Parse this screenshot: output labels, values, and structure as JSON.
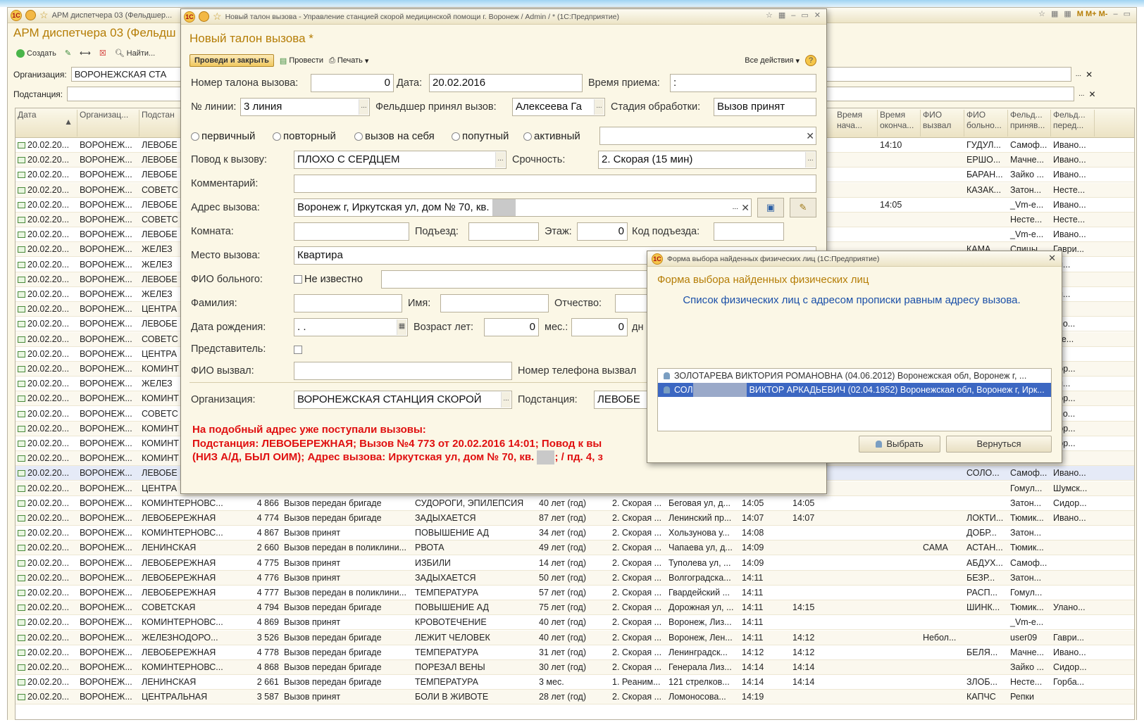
{
  "main": {
    "window_title": "АРМ диспетчера 03 (Фельдшер...",
    "title": "АРМ диспетчера 03 (Фельдш",
    "toolbar": {
      "create": "Создать",
      "find": "Найти..."
    },
    "org_label": "Организация:",
    "org_value": "ВОРОНЕЖСКАЯ СТА",
    "sub_label": "Подстанция:",
    "right_icons": "M M+ M-",
    "grid": {
      "headers_left": [
        "Дата",
        "Организац...",
        "Подстан"
      ],
      "headers_right": [
        "Время нача...",
        "Время оконча...",
        "ФИО вызвал",
        "ФИО больно...",
        "Фельд... приняв...",
        "Фельд... перед..."
      ],
      "upper_rows": [
        {
          "d": "20.02.20...",
          "o": "ВОРОНЕЖ...",
          "s": "ЛЕВОБЕ",
          "r": [
            "",
            "14:10",
            "",
            "ГУДУЛ...",
            "Самоф...",
            "Ивано..."
          ]
        },
        {
          "d": "20.02.20...",
          "o": "ВОРОНЕЖ...",
          "s": "ЛЕВОБЕ",
          "r": [
            "",
            "",
            "",
            "ЕРШО...",
            "Мачне...",
            "Ивано..."
          ]
        },
        {
          "d": "20.02.20...",
          "o": "ВОРОНЕЖ...",
          "s": "ЛЕВОБЕ",
          "r": [
            "",
            "",
            "",
            "БАРАН...",
            "Зайко ...",
            "Ивано..."
          ]
        },
        {
          "d": "20.02.20...",
          "o": "ВОРОНЕЖ...",
          "s": "СОВЕТС",
          "r": [
            "",
            "",
            "",
            "КАЗАК...",
            "Затон...",
            "Несте..."
          ]
        },
        {
          "d": "20.02.20...",
          "o": "ВОРОНЕЖ...",
          "s": "ЛЕВОБЕ",
          "r": [
            "",
            "14:05",
            "",
            "",
            "_Vm-e...",
            "Ивано..."
          ]
        },
        {
          "d": "20.02.20...",
          "o": "ВОРОНЕЖ...",
          "s": "СОВЕТС",
          "r": [
            "",
            "",
            "",
            "",
            "Несте...",
            "Несте..."
          ]
        },
        {
          "d": "20.02.20...",
          "o": "ВОРОНЕЖ...",
          "s": "ЛЕВОБЕ",
          "r": [
            "",
            "",
            "",
            "",
            "_Vm-e...",
            "Ивано..."
          ]
        },
        {
          "d": "20.02.20...",
          "o": "ВОРОНЕЖ...",
          "s": "ЖЕЛЕЗ",
          "r": [
            "",
            "",
            "",
            "КАМА...",
            "Спицы...",
            "Гаври..."
          ]
        },
        {
          "d": "20.02.20...",
          "o": "ВОРОНЕЖ...",
          "s": "ЖЕЛЕЗ",
          "r": [
            "",
            "",
            "",
            "",
            "",
            "ри..."
          ]
        },
        {
          "d": "20.02.20...",
          "o": "ВОРОНЕЖ...",
          "s": "ЛЕВОБЕ",
          "r": [
            "",
            "",
            "",
            "",
            "",
            ""
          ]
        },
        {
          "d": "20.02.20...",
          "o": "ВОРОНЕЖ...",
          "s": "ЖЕЛЕЗ",
          "r": [
            "",
            "",
            "",
            "",
            "",
            "ри..."
          ]
        },
        {
          "d": "20.02.20...",
          "o": "ВОРОНЕЖ...",
          "s": "ЦЕНТРА",
          "r": [
            "",
            "",
            "",
            "",
            "",
            ""
          ]
        },
        {
          "d": "20.02.20...",
          "o": "ВОРОНЕЖ...",
          "s": "ЛЕВОБЕ",
          "r": [
            "",
            "",
            "",
            "",
            "",
            "ано..."
          ]
        },
        {
          "d": "20.02.20...",
          "o": "ВОРОНЕЖ...",
          "s": "СОВЕТС",
          "r": [
            "",
            "",
            "",
            "",
            "",
            "сте..."
          ]
        },
        {
          "d": "20.02.20...",
          "o": "ВОРОНЕЖ...",
          "s": "ЦЕНТРА",
          "r": [
            "",
            "",
            "",
            "",
            "",
            ""
          ]
        },
        {
          "d": "20.02.20...",
          "o": "ВОРОНЕЖ...",
          "s": "КОМИНТ",
          "r": [
            "",
            "",
            "",
            "",
            "",
            "дор..."
          ]
        },
        {
          "d": "20.02.20...",
          "o": "ВОРОНЕЖ...",
          "s": "ЖЕЛЕЗ",
          "r": [
            "",
            "",
            "",
            "",
            "",
            "ри..."
          ]
        },
        {
          "d": "20.02.20...",
          "o": "ВОРОНЕЖ...",
          "s": "КОМИНТ",
          "r": [
            "",
            "",
            "",
            "",
            "",
            "дор..."
          ]
        },
        {
          "d": "20.02.20...",
          "o": "ВОРОНЕЖ...",
          "s": "СОВЕТС",
          "r": [
            "",
            "",
            "",
            "",
            "",
            "ано..."
          ]
        },
        {
          "d": "20.02.20...",
          "o": "ВОРОНЕЖ...",
          "s": "КОМИНТ",
          "r": [
            "",
            "",
            "",
            "",
            "",
            "дор..."
          ]
        },
        {
          "d": "20.02.20...",
          "o": "ВОРОНЕЖ...",
          "s": "КОМИНТ",
          "r": [
            "",
            "",
            "",
            "",
            "",
            "дор..."
          ]
        },
        {
          "d": "20.02.20...",
          "o": "ВОРОНЕЖ...",
          "s": "КОМИНТ",
          "r": [
            "",
            "",
            "",
            "",
            "",
            ""
          ]
        },
        {
          "d": "20.02.20...",
          "o": "ВОРОНЕЖ...",
          "s": "ЛЕВОБЕ",
          "r": [
            "",
            "",
            "",
            "СОЛО...",
            "Самоф...",
            "Ивано..."
          ]
        },
        {
          "d": "20.02.20...",
          "o": "ВОРОНЕЖ...",
          "s": "ЦЕНТРА",
          "r": [
            "",
            "",
            "",
            "",
            "Гомул...",
            "Шумск..."
          ]
        }
      ],
      "full_rows": [
        [
          "20.02.20...",
          "ВОРОНЕЖ...",
          "КОМИНТЕРНОВС...",
          "4 866",
          "Вызов передан бригаде",
          "СУДОРОГИ, ЭПИЛЕПСИЯ",
          "40 лет (год)",
          "2. Скорая ...",
          "Беговая ул, д...",
          "14:05",
          "14:05",
          "",
          "",
          "Затон...",
          "Сидор..."
        ],
        [
          "20.02.20...",
          "ВОРОНЕЖ...",
          "ЛЕВОБЕРЕЖНАЯ",
          "4 774",
          "Вызов передан бригаде",
          "ЗАДЫХАЕТСЯ",
          "87 лет (год)",
          "2. Скорая ...",
          "Ленинский пр...",
          "14:07",
          "14:07",
          "",
          "ЛОКТИ...",
          "Тюмик...",
          "Ивано..."
        ],
        [
          "20.02.20...",
          "ВОРОНЕЖ...",
          "КОМИНТЕРНОВС...",
          "4 867",
          "Вызов принят",
          "ПОВЫШЕНИЕ АД",
          "34 лет (год)",
          "2. Скорая ...",
          "Хользунова у...",
          "14:08",
          "",
          "",
          "ДОБР...",
          "Затон...",
          ""
        ],
        [
          "20.02.20...",
          "ВОРОНЕЖ...",
          "ЛЕНИНСКАЯ",
          "2 660",
          "Вызов передан в поликлини...",
          "РВОТА",
          "49 лет (год)",
          "2. Скорая ...",
          "Чапаева ул, д...",
          "14:09",
          "",
          "САМА",
          "АСТАН...",
          "Тюмик...",
          ""
        ],
        [
          "20.02.20...",
          "ВОРОНЕЖ...",
          "ЛЕВОБЕРЕЖНАЯ",
          "4 775",
          "Вызов принят",
          "ИЗБИЛИ",
          "14 лет (год)",
          "2. Скорая ...",
          "Туполева ул, ...",
          "14:09",
          "",
          "",
          "АБДУХ...",
          "Самоф...",
          ""
        ],
        [
          "20.02.20...",
          "ВОРОНЕЖ...",
          "ЛЕВОБЕРЕЖНАЯ",
          "4 776",
          "Вызов принят",
          "ЗАДЫХАЕТСЯ",
          "50 лет (год)",
          "2. Скорая ...",
          "Волгоградска...",
          "14:11",
          "",
          "",
          "БЕЗР...",
          "Затон...",
          ""
        ],
        [
          "20.02.20...",
          "ВОРОНЕЖ...",
          "ЛЕВОБЕРЕЖНАЯ",
          "4 777",
          "Вызов передан в поликлини...",
          "ТЕМПЕРАТУРА",
          "57 лет (год)",
          "2. Скорая ...",
          "Гвардейский ...",
          "14:11",
          "",
          "",
          "РАСП...",
          "Гомул...",
          ""
        ],
        [
          "20.02.20...",
          "ВОРОНЕЖ...",
          "СОВЕТСКАЯ",
          "4 794",
          "Вызов передан бригаде",
          "ПОВЫШЕНИЕ АД",
          "75 лет (год)",
          "2. Скорая ...",
          "Дорожная ул, ...",
          "14:11",
          "14:15",
          "",
          "ШИНК...",
          "Тюмик...",
          "Улано..."
        ],
        [
          "20.02.20...",
          "ВОРОНЕЖ...",
          "КОМИНТЕРНОВС...",
          "4 869",
          "Вызов принят",
          "КРОВОТЕЧЕНИЕ",
          "40 лет (год)",
          "2. Скорая ...",
          "Воронеж, Лиз...",
          "14:11",
          "",
          "",
          "",
          "_Vm-e...",
          ""
        ],
        [
          "20.02.20...",
          "ВОРОНЕЖ...",
          "ЖЕЛЕЗНОДОРО...",
          "3 526",
          "Вызов передан бригаде",
          "ЛЕЖИТ ЧЕЛОВЕК",
          "40 лет (год)",
          "2. Скорая ...",
          "Воронеж, Лен...",
          "14:11",
          "14:12",
          "Небол...",
          "",
          "user09",
          "Гаври..."
        ],
        [
          "20.02.20...",
          "ВОРОНЕЖ...",
          "ЛЕВОБЕРЕЖНАЯ",
          "4 778",
          "Вызов передан бригаде",
          "ТЕМПЕРАТУРА",
          "31 лет (год)",
          "2. Скорая ...",
          "Ленинградск...",
          "14:12",
          "14:12",
          "",
          "БЕЛЯ...",
          "Мачне...",
          "Ивано..."
        ],
        [
          "20.02.20...",
          "ВОРОНЕЖ...",
          "КОМИНТЕРНОВС...",
          "4 868",
          "Вызов передан бригаде",
          "ПОРЕЗАЛ ВЕНЫ",
          "30 лет (год)",
          "2. Скорая ...",
          "Генерала Лиз...",
          "14:14",
          "14:14",
          "",
          "",
          "Зайко ...",
          "Сидор..."
        ],
        [
          "20.02.20...",
          "ВОРОНЕЖ...",
          "ЛЕНИНСКАЯ",
          "2 661",
          "Вызов передан бригаде",
          "ТЕМПЕРАТУРА",
          "3 мес.",
          "1. Реаним...",
          "121 стрелков...",
          "14:14",
          "14:14",
          "",
          "ЗЛОБ...",
          "Несте...",
          "Горба..."
        ],
        [
          "20.02.20...",
          "ВОРОНЕЖ...",
          "ЦЕНТРАЛЬНАЯ",
          "3 587",
          "Вызов принят",
          "БОЛИ В ЖИВОТЕ",
          "28 лет (год)",
          "2. Скорая ...",
          "Ломоносова...",
          "14:19",
          "",
          "",
          "КАПЧС",
          "Репки",
          ""
        ]
      ]
    }
  },
  "dialog": {
    "window_title": "Новый талон вызова - Управление станцией скорой медицинской помощи г. Воронеж / Admin / * (1С:Предприятие)",
    "heading": "Новый талон вызова *",
    "toolbar": {
      "post_close": "Проведи и закрыть",
      "post": "Провести",
      "print": "Печать",
      "all_actions": "Все действия"
    },
    "f": {
      "ticket_no_label": "Номер талона вызова:",
      "ticket_no": "0",
      "date_label": "Дата:",
      "date": "20.02.2016",
      "time_label": "Время приема:",
      "time": " :",
      "line_label": "№ линии:",
      "line": "3 линия",
      "medic_label": "Фельдшер принял вызов:",
      "medic": "Алексеева Га",
      "stage_label": "Стадия обработки:",
      "stage": "Вызов принят",
      "radio1": "первичный",
      "radio2": "повторный",
      "radio3": "вызов на себя",
      "radio4": "попутный",
      "radio5": "активный",
      "reason_label": "Повод к вызову:",
      "reason": "ПЛОХО С СЕРДЦЕМ",
      "urgency_label": "Срочность:",
      "urgency": "2. Скорая (15 мин)",
      "comment_label": "Комментарий:",
      "address_label": "Адрес вызова:",
      "address": "Воронеж г, Иркутская ул, дом № 70, кв.",
      "room_label": "Комната:",
      "entrance_label": "Подъезд:",
      "floor_label": "Этаж:",
      "floor": "0",
      "code_label": "Код подъезда:",
      "place_label": "Место вызова:",
      "place": "Квартира",
      "fio_label": "ФИО больного:",
      "unknown": "Не известно",
      "surname_label": "Фамилия:",
      "name_label": "Имя:",
      "patronymic_label": "Отчество:",
      "birth_label": "Дата рождения:",
      "birth": " .  .",
      "age_label": "Возраст лет:",
      "age": "0",
      "months_label": "мес.:",
      "months": "0",
      "days_label": "дн",
      "rep_label": "Представитель:",
      "caller_label": "ФИО вызвал:",
      "phone_label": "Номер телефона вызвал",
      "org_label": "Организация:",
      "org": "ВОРОНЕЖСКАЯ  СТАНЦИЯ СКОРОЙ",
      "sub_label": "Подстанция:",
      "sub": "ЛЕВОБЕ"
    },
    "warning": {
      "l1": "На подобный адрес уже поступали вызовы:",
      "l2": "Подстанция: ЛЕВОБЕРЕЖНАЯ; Вызов №4 773 от 20.02.2016 14:01; Повод к вы",
      "l3a": "(НИЗ А/Д,  БЫЛ ОИМ); Адрес вызова: Иркутская ул, дом № 70, кв.",
      "l3b": "; / пд. 4, з"
    }
  },
  "dialog2": {
    "window_title": "Форма выбора найденных физических лиц  (1С:Предприятие)",
    "heading": "Форма выбора найденных физических лиц",
    "message": "Список физических лиц с адресом прописки равным адресу вызова.",
    "items": [
      {
        "a": "ЗОЛОТАРЕВА ВИКТОРИЯ РОМАНОВНА (04.06.2012) Воронежская обл, Воронеж г, ..."
      },
      {
        "a": "СОЛ",
        "b": "ВИКТОР АРКАДЬЕВИЧ (02.04.1952) Воронежская обл, Воронеж г, Ирк..."
      }
    ],
    "select": "Выбрать",
    "back": "Вернуться"
  }
}
